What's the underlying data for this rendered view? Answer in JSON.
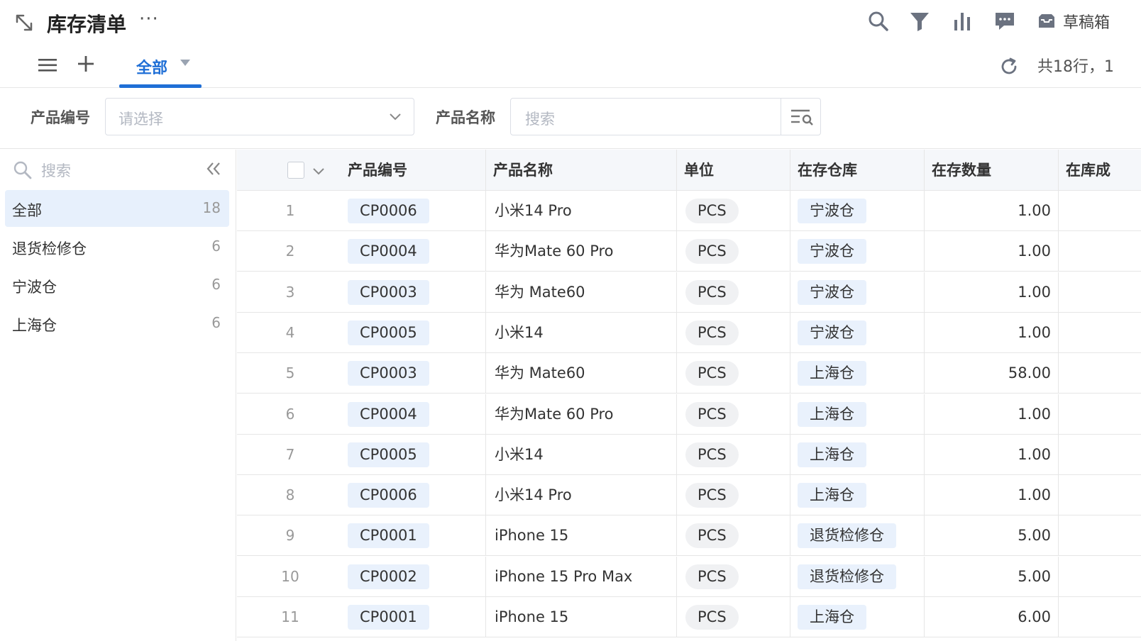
{
  "header": {
    "title": "库存清单",
    "more": "···",
    "drafts_label": "草稿箱"
  },
  "tabs": {
    "active_label": "全部"
  },
  "row_count_text": "共18行，1",
  "filters": {
    "code_label": "产品编号",
    "code_placeholder": "请选择",
    "name_label": "产品名称",
    "name_placeholder": "搜索"
  },
  "sidebar": {
    "search_placeholder": "搜索",
    "items": [
      {
        "label": "全部",
        "count": "18"
      },
      {
        "label": "退货检修仓",
        "count": "6"
      },
      {
        "label": "宁波仓",
        "count": "6"
      },
      {
        "label": "上海仓",
        "count": "6"
      }
    ]
  },
  "table": {
    "columns": [
      "产品编号",
      "产品名称",
      "单位",
      "在存仓库",
      "在存数量",
      "在库成"
    ],
    "rows": [
      {
        "idx": "1",
        "code": "CP0006",
        "name": "小米14 Pro",
        "unit": "PCS",
        "warehouse": "宁波仓",
        "qty": "1.00"
      },
      {
        "idx": "2",
        "code": "CP0004",
        "name": "华为Mate 60 Pro",
        "unit": "PCS",
        "warehouse": "宁波仓",
        "qty": "1.00"
      },
      {
        "idx": "3",
        "code": "CP0003",
        "name": "华为 Mate60",
        "unit": "PCS",
        "warehouse": "宁波仓",
        "qty": "1.00"
      },
      {
        "idx": "4",
        "code": "CP0005",
        "name": "小米14",
        "unit": "PCS",
        "warehouse": "宁波仓",
        "qty": "1.00"
      },
      {
        "idx": "5",
        "code": "CP0003",
        "name": "华为 Mate60",
        "unit": "PCS",
        "warehouse": "上海仓",
        "qty": "58.00"
      },
      {
        "idx": "6",
        "code": "CP0004",
        "name": "华为Mate 60 Pro",
        "unit": "PCS",
        "warehouse": "上海仓",
        "qty": "1.00"
      },
      {
        "idx": "7",
        "code": "CP0005",
        "name": "小米14",
        "unit": "PCS",
        "warehouse": "上海仓",
        "qty": "1.00"
      },
      {
        "idx": "8",
        "code": "CP0006",
        "name": "小米14 Pro",
        "unit": "PCS",
        "warehouse": "上海仓",
        "qty": "1.00"
      },
      {
        "idx": "9",
        "code": "CP0001",
        "name": "iPhone 15",
        "unit": "PCS",
        "warehouse": "退货检修仓",
        "qty": "5.00"
      },
      {
        "idx": "10",
        "code": "CP0002",
        "name": "iPhone 15 Pro Max",
        "unit": "PCS",
        "warehouse": "退货检修仓",
        "qty": "5.00"
      },
      {
        "idx": "11",
        "code": "CP0001",
        "name": "iPhone 15",
        "unit": "PCS",
        "warehouse": "上海仓",
        "qty": "6.00"
      }
    ]
  },
  "colors": {
    "accent": "#1f6fd6",
    "tag_bg": "#e9f1fc",
    "active_bg": "#e7f0fc"
  }
}
